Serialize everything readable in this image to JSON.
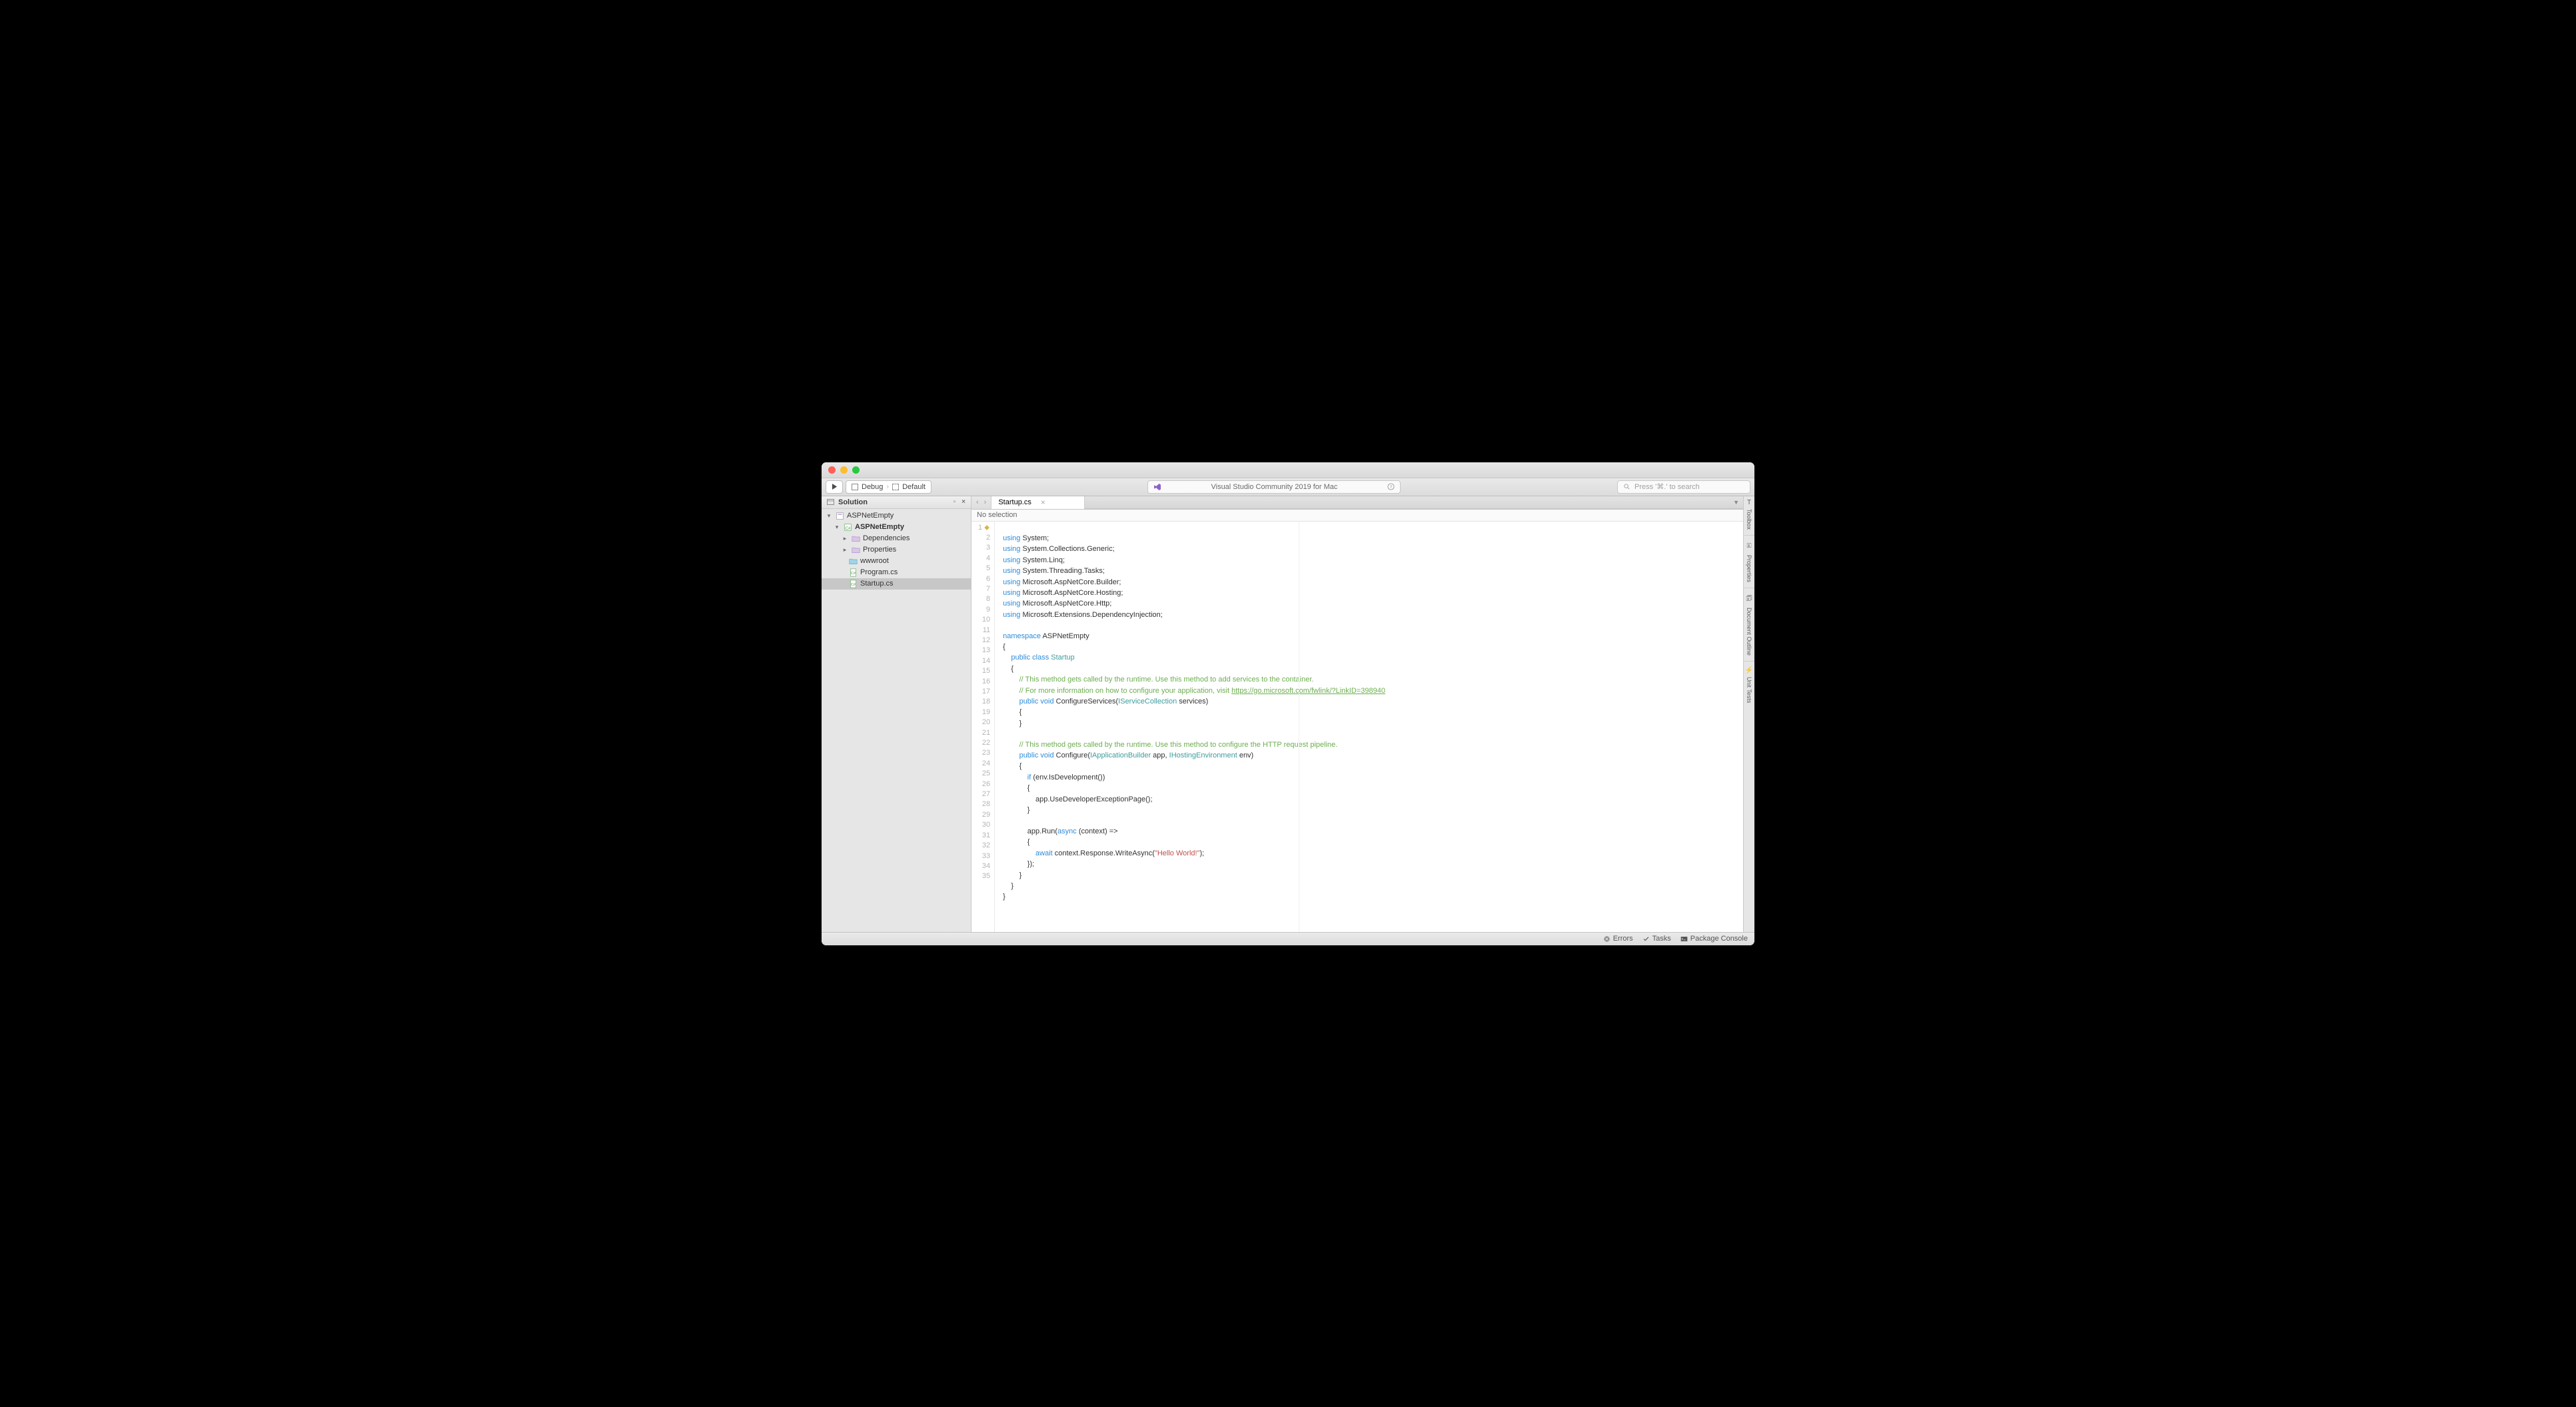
{
  "app_title": "Visual Studio Community 2019 for Mac",
  "search_placeholder": "Press '⌘.' to search",
  "toolbar": {
    "config": "Debug",
    "target": "Default"
  },
  "sidebar": {
    "title": "Solution",
    "solution": "ASPNetEmpty",
    "project": "ASPNetEmpty",
    "deps": "Dependencies",
    "props": "Properties",
    "wwwroot": "wwwroot",
    "program": "Program.cs",
    "startup": "Startup.cs"
  },
  "tab": {
    "name": "Startup.cs"
  },
  "breadcrumb": "No selection",
  "statusbar": {
    "errors": "Errors",
    "tasks": "Tasks",
    "package": "Package Console"
  },
  "rightbar": {
    "toolbox": "Toolbox",
    "properties": "Properties",
    "outline": "Document Outline",
    "tests": "Unit Tests"
  },
  "code": {
    "l1_a": "using",
    "l1_b": " System;",
    "l2_a": "using",
    "l2_b": " System.Collections.Generic;",
    "l3_a": "using",
    "l3_b": " System.Linq;",
    "l4_a": "using",
    "l4_b": " System.Threading.Tasks;",
    "l5_a": "using",
    "l5_b": " Microsoft.AspNetCore.Builder;",
    "l6_a": "using",
    "l6_b": " Microsoft.AspNetCore.Hosting;",
    "l7_a": "using",
    "l7_b": " Microsoft.AspNetCore.Http;",
    "l8_a": "using",
    "l8_b": " Microsoft.Extensions.DependencyInjection;",
    "l10_a": "namespace",
    "l10_b": " ASPNetEmpty",
    "l11": "{",
    "l12_a": "    public",
    "l12_b": " class",
    "l12_c": " Startup",
    "l13": "    {",
    "l14": "        // This method gets called by the runtime. Use this method to add services to the container.",
    "l15_a": "        // For more information on how to configure your application, visit ",
    "l15_b": "https://go.microsoft.com/fwlink/?LinkID=398940",
    "l16_a": "        public",
    "l16_b": " void",
    "l16_c": " ConfigureServices(",
    "l16_d": "IServiceCollection",
    "l16_e": " services)",
    "l17": "        {",
    "l18": "        }",
    "l20": "        // This method gets called by the runtime. Use this method to configure the HTTP request pipeline.",
    "l21_a": "        public",
    "l21_b": " void",
    "l21_c": " Configure(",
    "l21_d": "IApplicationBuilder",
    "l21_e": " app, ",
    "l21_f": "IHostingEnvironment",
    "l21_g": " env)",
    "l22": "        {",
    "l23_a": "            if",
    "l23_b": " (env.IsDevelopment())",
    "l24": "            {",
    "l25": "                app.UseDeveloperExceptionPage();",
    "l26": "            }",
    "l28_a": "            app.Run(",
    "l28_b": "async",
    "l28_c": " (context) =>",
    "l29": "            {",
    "l30_a": "                await",
    "l30_b": " context.Response.WriteAsync(",
    "l30_c": "\"Hello World!\"",
    "l30_d": ");",
    "l31": "            });",
    "l32": "        }",
    "l33": "    }",
    "l34": "}"
  }
}
